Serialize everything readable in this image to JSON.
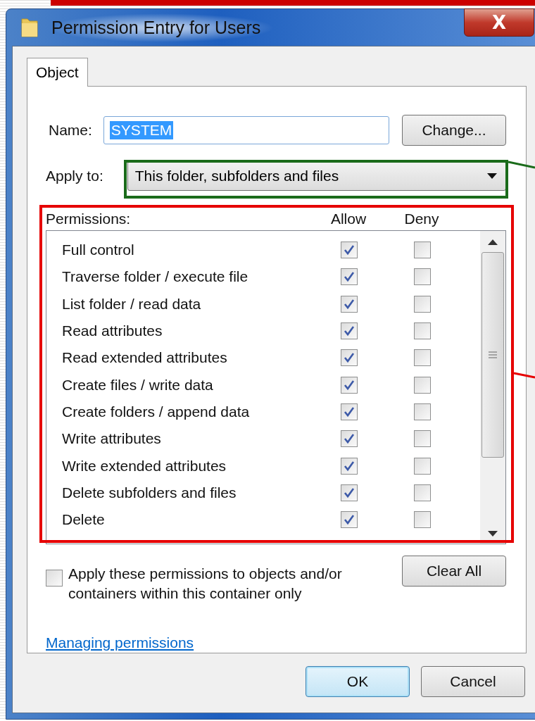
{
  "window": {
    "title": "Permission Entry for Users",
    "close": "X"
  },
  "tabs": [
    {
      "label": "Object",
      "selected": true
    }
  ],
  "name": {
    "label": "Name:",
    "value": "SYSTEM",
    "button": "Change..."
  },
  "apply_to": {
    "label": "Apply to:",
    "value": "This folder, subfolders and files"
  },
  "permissions": {
    "label": "Permissions:",
    "columns": [
      "Allow",
      "Deny"
    ],
    "rows": [
      {
        "label": "Full control",
        "allow": true,
        "deny": false
      },
      {
        "label": "Traverse folder / execute file",
        "allow": true,
        "deny": false
      },
      {
        "label": "List folder / read data",
        "allow": true,
        "deny": false
      },
      {
        "label": "Read attributes",
        "allow": true,
        "deny": false
      },
      {
        "label": "Read extended attributes",
        "allow": true,
        "deny": false
      },
      {
        "label": "Create files / write data",
        "allow": true,
        "deny": false
      },
      {
        "label": "Create folders / append data",
        "allow": true,
        "deny": false
      },
      {
        "label": "Write attributes",
        "allow": true,
        "deny": false
      },
      {
        "label": "Write extended attributes",
        "allow": true,
        "deny": false
      },
      {
        "label": "Delete subfolders and files",
        "allow": true,
        "deny": false
      },
      {
        "label": "Delete",
        "allow": true,
        "deny": false
      }
    ]
  },
  "apply_only": {
    "label": "Apply these permissions to objects and/or containers within this container only",
    "checked": false
  },
  "clear_all": "Clear All",
  "link": "Managing permissions",
  "buttons": [
    {
      "label": "OK",
      "default": true
    },
    {
      "label": "Cancel",
      "default": false
    }
  ]
}
